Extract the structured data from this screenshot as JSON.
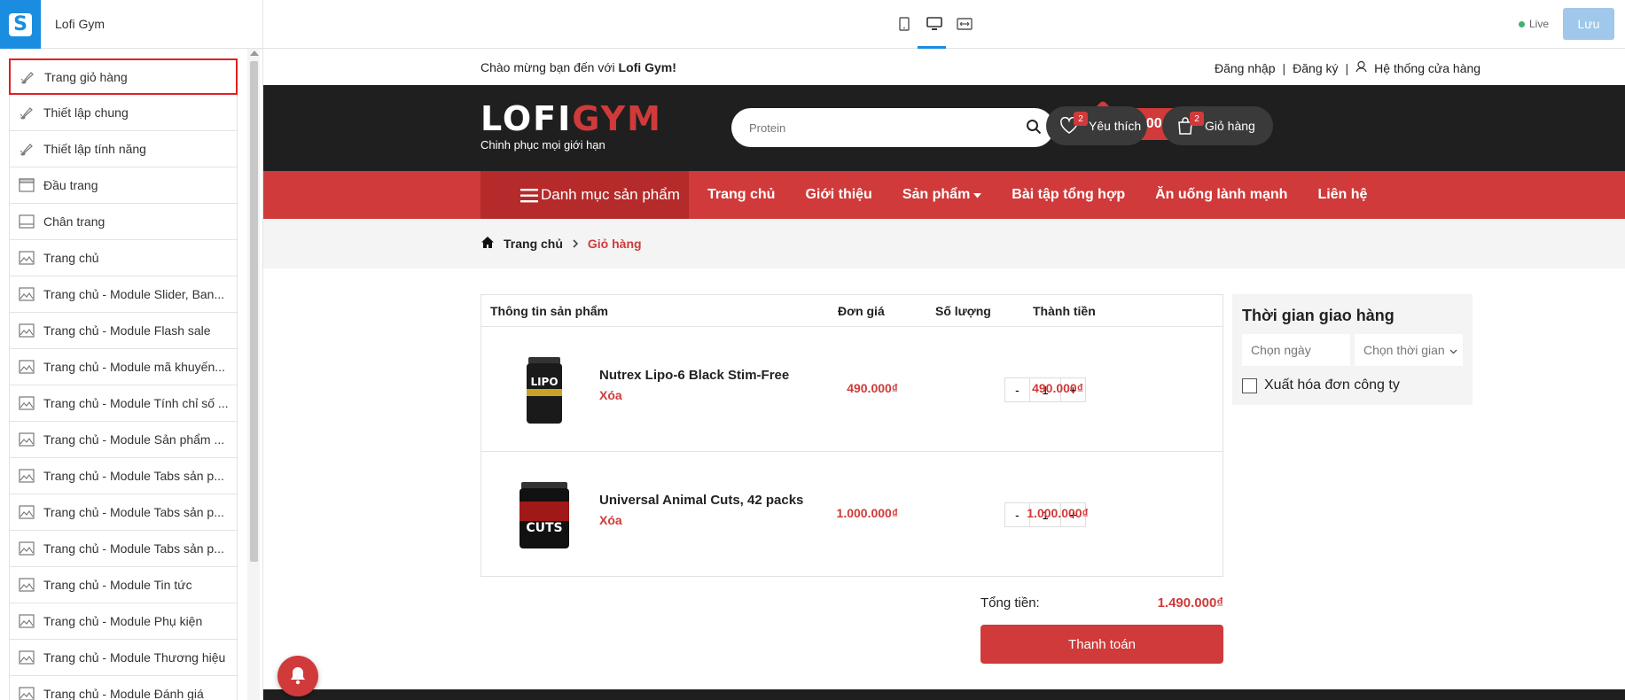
{
  "app": {
    "title": "Lofi Gym",
    "logo_letter": "S",
    "live_label": "Live",
    "save_label": "Lưu"
  },
  "sidebar": {
    "items": [
      {
        "label": "Trang giỏ hàng",
        "icon": "brush-icon"
      },
      {
        "label": "Thiết lập chung",
        "icon": "brush-icon"
      },
      {
        "label": "Thiết lập tính năng",
        "icon": "brush-icon"
      },
      {
        "label": "Đầu trang",
        "icon": "header-layout-icon"
      },
      {
        "label": "Chân trang",
        "icon": "footer-layout-icon"
      },
      {
        "label": "Trang chủ",
        "icon": "image-icon"
      },
      {
        "label": "Trang chủ - Module Slider, Ban...",
        "icon": "image-icon"
      },
      {
        "label": "Trang chủ - Module Flash sale",
        "icon": "image-icon"
      },
      {
        "label": "Trang chủ - Module mã khuyến...",
        "icon": "image-icon"
      },
      {
        "label": "Trang chủ - Module Tính chỉ số ...",
        "icon": "image-icon"
      },
      {
        "label": "Trang chủ - Module Sản phẩm ...",
        "icon": "image-icon"
      },
      {
        "label": "Trang chủ - Module Tabs sản p...",
        "icon": "image-icon"
      },
      {
        "label": "Trang chủ - Module Tabs sản p...",
        "icon": "image-icon"
      },
      {
        "label": "Trang chủ - Module Tabs sản p...",
        "icon": "image-icon"
      },
      {
        "label": "Trang chủ - Module Tin tức",
        "icon": "image-icon"
      },
      {
        "label": "Trang chủ - Module Phụ kiện",
        "icon": "image-icon"
      },
      {
        "label": "Trang chủ - Module Thương hiệu",
        "icon": "image-icon"
      },
      {
        "label": "Trang chủ - Module Đánh giá",
        "icon": "image-icon"
      }
    ]
  },
  "store": {
    "welcome_prefix": "Chào mừng bạn đến với ",
    "welcome_brand": "Lofi Gym!",
    "login": "Đăng nhập",
    "register": "Đăng ký",
    "stores": "Hệ thống cửa hàng",
    "logo_left": "LOFI",
    "logo_right": "GYM",
    "tagline": "Chinh phục mọi giới hạn",
    "search_placeholder": "Protein",
    "hotline": "1900 6750",
    "wishlist_label": "Yêu thích",
    "wishlist_count": "2",
    "cart_label": "Giỏ hàng",
    "cart_count": "2",
    "category_menu": "Danh mục sản phẩm",
    "nav": [
      "Trang chủ",
      "Giới thiệu",
      "Sản phẩm",
      "Bài tập tổng hợp",
      "Ăn uống lành mạnh",
      "Liên hệ"
    ],
    "breadcrumb_home": "Trang chủ",
    "breadcrumb_current": "Giỏ hàng"
  },
  "cart": {
    "headers": {
      "product": "Thông tin sản phẩm",
      "price": "Đơn giá",
      "qty": "Số lượng",
      "subtotal": "Thành tiền"
    },
    "rows": [
      {
        "name": "Nutrex Lipo-6 Black Stim-Free",
        "delete": "Xóa",
        "price": "490.000₫",
        "qty": "1",
        "subtotal": "490.000₫",
        "image_label": "LIPO"
      },
      {
        "name": "Universal Animal Cuts, 42 packs",
        "delete": "Xóa",
        "price": "1.000.000₫",
        "qty": "1",
        "subtotal": "1.000.000₫",
        "image_label": "CUTS"
      }
    ],
    "minus": "-",
    "plus": "+",
    "total_label": "Tổng tiền:",
    "total_value": "1.490.000₫",
    "checkout_label": "Thanh toán"
  },
  "delivery": {
    "title": "Thời gian giao hàng",
    "date_placeholder": "Chọn ngày",
    "time_placeholder": "Chọn thời gian",
    "invoice_label": "Xuất hóa đơn công ty"
  },
  "colors": {
    "accent": "#d03a3a",
    "brand_blue": "#1a8de0",
    "header_dark": "#1f1f1f"
  }
}
